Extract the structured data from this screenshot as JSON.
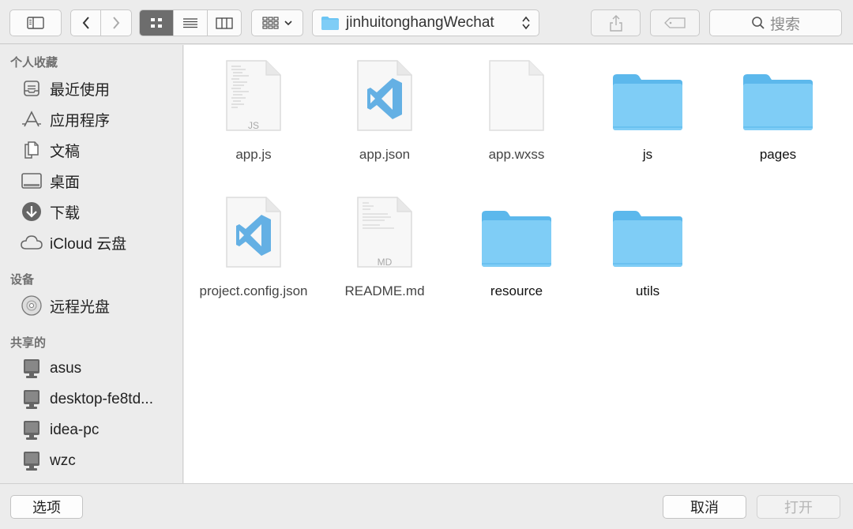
{
  "toolbar": {
    "sidebar_toggle_icon": "sidebar-toggle-icon",
    "back_icon": "chevron-left-icon",
    "forward_icon": "chevron-right-icon",
    "view_modes": [
      "icon-view",
      "list-view",
      "column-view"
    ],
    "active_view": "icon-view",
    "arrange_icon": "arrange-grid-icon",
    "path_label": "jinhuitonghangWechat",
    "share_icon": "share-icon",
    "tag_icon": "tag-icon",
    "search_placeholder": "搜索"
  },
  "sidebar": {
    "sections": [
      {
        "title": "个人收藏",
        "items": [
          {
            "label": "最近使用",
            "icon": "recents-icon"
          },
          {
            "label": "应用程序",
            "icon": "applications-icon"
          },
          {
            "label": "文稿",
            "icon": "documents-icon"
          },
          {
            "label": "桌面",
            "icon": "desktop-icon"
          },
          {
            "label": "下载",
            "icon": "downloads-icon"
          },
          {
            "label": "iCloud 云盘",
            "icon": "cloud-icon"
          }
        ]
      },
      {
        "title": "设备",
        "items": [
          {
            "label": "远程光盘",
            "icon": "disc-icon"
          }
        ]
      },
      {
        "title": "共享的",
        "items": [
          {
            "label": "asus",
            "icon": "computer-icon"
          },
          {
            "label": "desktop-fe8td...",
            "icon": "computer-icon"
          },
          {
            "label": "idea-pc",
            "icon": "computer-icon"
          },
          {
            "label": "wzc",
            "icon": "computer-icon"
          }
        ]
      }
    ]
  },
  "files": [
    {
      "name": "app.js",
      "kind": "js-file",
      "badge": "JS"
    },
    {
      "name": "app.json",
      "kind": "vscode-file"
    },
    {
      "name": "app.wxss",
      "kind": "blank-file"
    },
    {
      "name": "js",
      "kind": "folder"
    },
    {
      "name": "pages",
      "kind": "folder"
    },
    {
      "name": "project.config.json",
      "kind": "vscode-file"
    },
    {
      "name": "README.md",
      "kind": "md-file",
      "badge": "MD"
    },
    {
      "name": "resource",
      "kind": "folder"
    },
    {
      "name": "utils",
      "kind": "folder"
    }
  ],
  "buttons": {
    "options": "选项",
    "cancel": "取消",
    "open": "打开"
  },
  "colors": {
    "folder": "#6cc5f4",
    "folder_tab": "#8dd4f8",
    "vscode_blue": "#4aa3e0",
    "active_segment": "#6d6d6d"
  }
}
